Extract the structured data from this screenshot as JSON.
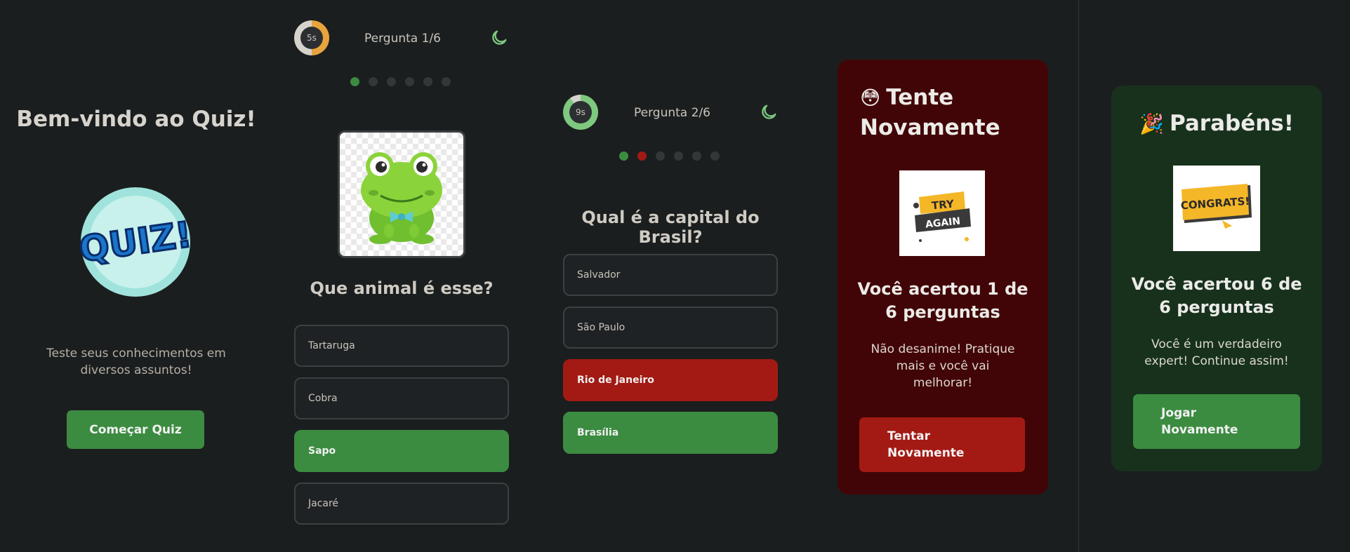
{
  "welcome": {
    "title": "Bem-vindo ao Quiz!",
    "logo_text": "QUIZ!",
    "description": "Teste seus conhecimentos em diversos assuntos!",
    "start_button": "Começar Quiz"
  },
  "question1": {
    "timer": "5s",
    "timer_fraction": 0.5,
    "counter": "Pergunta 1/6",
    "progress_dots": [
      "current",
      "pending",
      "pending",
      "pending",
      "pending",
      "pending"
    ],
    "question": "Que animal é esse?",
    "options": [
      {
        "label": "Tartaruga",
        "state": "default"
      },
      {
        "label": "Cobra",
        "state": "default"
      },
      {
        "label": "Sapo",
        "state": "correct"
      },
      {
        "label": "Jacaré",
        "state": "default"
      }
    ]
  },
  "question2": {
    "timer": "9s",
    "timer_fraction": 0.9,
    "counter": "Pergunta 2/6",
    "progress_dots": [
      "correct",
      "wrong",
      "pending",
      "pending",
      "pending",
      "pending"
    ],
    "question": "Qual é a capital do Brasil?",
    "options": [
      {
        "label": "Salvador",
        "state": "default"
      },
      {
        "label": "São Paulo",
        "state": "default"
      },
      {
        "label": "Rio de Janeiro",
        "state": "wrong"
      },
      {
        "label": "Brasília",
        "state": "correct"
      }
    ]
  },
  "result_fail": {
    "emoji": "😳",
    "title_line1": "Tente",
    "title_line2": "Novamente",
    "image_text_1": "TRY",
    "image_text_2": "AGAIN",
    "score": "Você acertou 1 de 6 perguntas",
    "message": "Não desanime! Pratique mais e você vai melhorar!",
    "button_line1": "Tentar",
    "button_line2": "Novamente"
  },
  "result_success": {
    "emoji": "🎉",
    "title": "Parabéns!",
    "image_text": "CONGRATS!",
    "score": "Você acertou 6 de 6 perguntas",
    "message": "Você é um verdadeiro expert! Continue assim!",
    "button_line1": "Jogar",
    "button_line2": "Novamente"
  },
  "colors": {
    "background": "#1b1e1f",
    "accent_green": "#3b8c40",
    "accent_red": "#a31a14",
    "timer_orange": "#e8a33d",
    "fail_card": "#420507",
    "success_card": "#17311d",
    "moon_icon": "#7ec87f"
  }
}
